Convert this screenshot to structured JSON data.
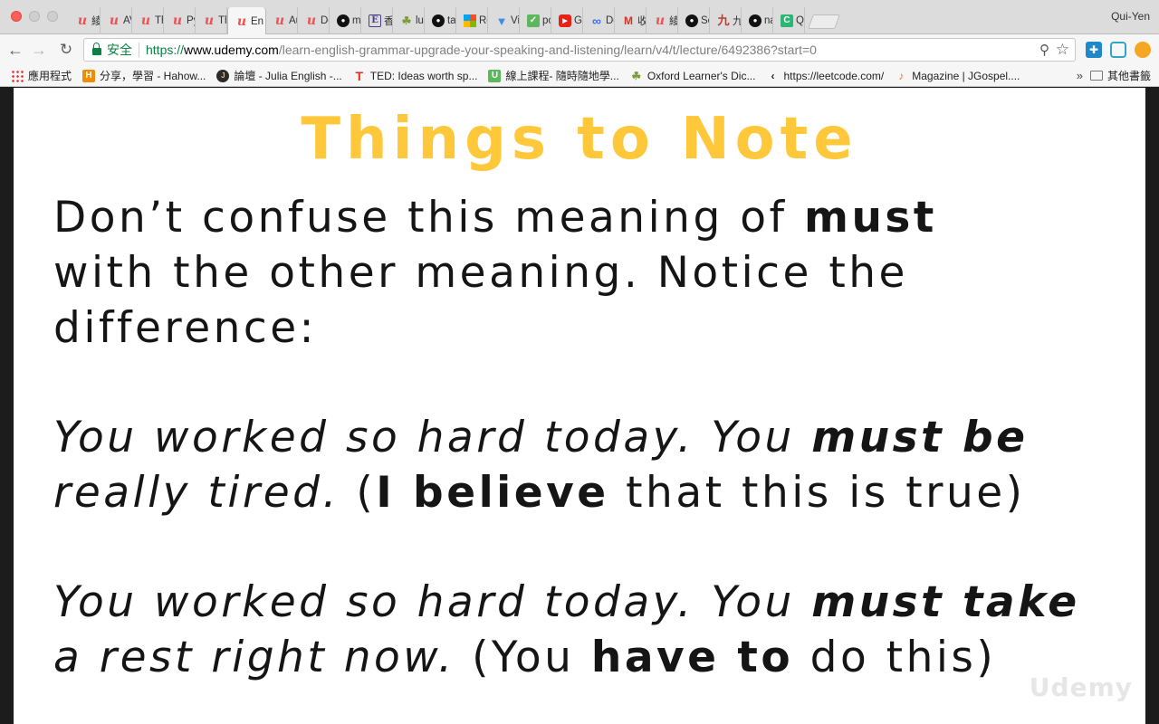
{
  "browser": {
    "profile_name": "Qui-Yen",
    "tabs": [
      {
        "favicon": "udemy-icon",
        "title": "綾",
        "active": false
      },
      {
        "favicon": "udemy-icon",
        "title": "AV",
        "active": false
      },
      {
        "favicon": "udemy-icon",
        "title": "Th",
        "active": false
      },
      {
        "favicon": "udemy-icon",
        "title": "Py",
        "active": false
      },
      {
        "favicon": "udemy-icon",
        "title": "Th",
        "active": false
      },
      {
        "favicon": "udemy-icon",
        "title": "En",
        "active": true
      },
      {
        "favicon": "udemy-icon",
        "title": "Au",
        "active": false
      },
      {
        "favicon": "udemy-icon",
        "title": "De",
        "active": false
      },
      {
        "favicon": "github-icon",
        "title": "m",
        "active": false
      },
      {
        "favicon": "ebook-icon",
        "title": "香",
        "active": false
      },
      {
        "favicon": "leaf-icon",
        "title": "lu",
        "active": false
      },
      {
        "favicon": "github-icon",
        "title": "ta",
        "active": false
      },
      {
        "favicon": "microsoft-icon",
        "title": "Re",
        "active": false
      },
      {
        "favicon": "funnel-icon",
        "title": "Vi",
        "active": false
      },
      {
        "favicon": "check-icon",
        "title": "pc",
        "active": false
      },
      {
        "favicon": "youtube-icon",
        "title": "G",
        "active": false
      },
      {
        "favicon": "infinity-icon",
        "title": "Do",
        "active": false
      },
      {
        "favicon": "gmail-icon",
        "title": "收",
        "active": false
      },
      {
        "favicon": "udemy-icon",
        "title": "綾",
        "active": false
      },
      {
        "favicon": "github-icon",
        "title": "Sc",
        "active": false
      },
      {
        "favicon": "jiuzhang-icon",
        "title": "九",
        "active": false
      },
      {
        "favicon": "github-icon",
        "title": "na",
        "active": false
      },
      {
        "favicon": "c-icon",
        "title": "Q",
        "active": false
      }
    ],
    "address": {
      "secure_label": "安全",
      "scheme": "https://",
      "host": "www.udemy.com",
      "path": "/learn-english-grammar-upgrade-your-speaking-and-listening/learn/v4/t/lecture/6492386?start=0"
    },
    "bookmarks": [
      {
        "icon": "apps-icon",
        "label": "應用程式"
      },
      {
        "icon": "hahow-icon",
        "label": "分享，學習 - Hahow..."
      },
      {
        "icon": "julia-english-icon",
        "label": "論壇 - Julia English -..."
      },
      {
        "icon": "ted-icon",
        "label": "TED: Ideas worth sp..."
      },
      {
        "icon": "u-icon",
        "label": "線上課程- 隨時隨地學..."
      },
      {
        "icon": "oxford-icon",
        "label": "Oxford Learner's Dic..."
      },
      {
        "icon": "leetcode-icon",
        "label": "https://leetcode.com/"
      },
      {
        "icon": "jgospel-icon",
        "label": "Magazine | JGospel...."
      }
    ],
    "bookmarks_overflow": "»",
    "other_bookmarks": "其他書籤"
  },
  "slide": {
    "title": "Things to Note",
    "intro": {
      "line1_pre": "Don’t confuse this meaning of ",
      "line1_bold": "must",
      "line2": "with the other meaning. Notice the",
      "line3": "difference:"
    },
    "example1": {
      "line1_pre": "You worked so hard today. You ",
      "line1_bold": "must be",
      "line2_pre": "really tired.",
      "line2_paren_open": " (",
      "line2_bold": "I believe",
      "line2_post": " that this is true)"
    },
    "example2": {
      "line1_pre": "You worked so hard today. You ",
      "line1_bold": "must take",
      "line2_pre": "a rest right now.",
      "line2_paren_open": " (You ",
      "line2_bold": "have to",
      "line2_post": " do this)"
    },
    "watermark": "Udemy"
  }
}
